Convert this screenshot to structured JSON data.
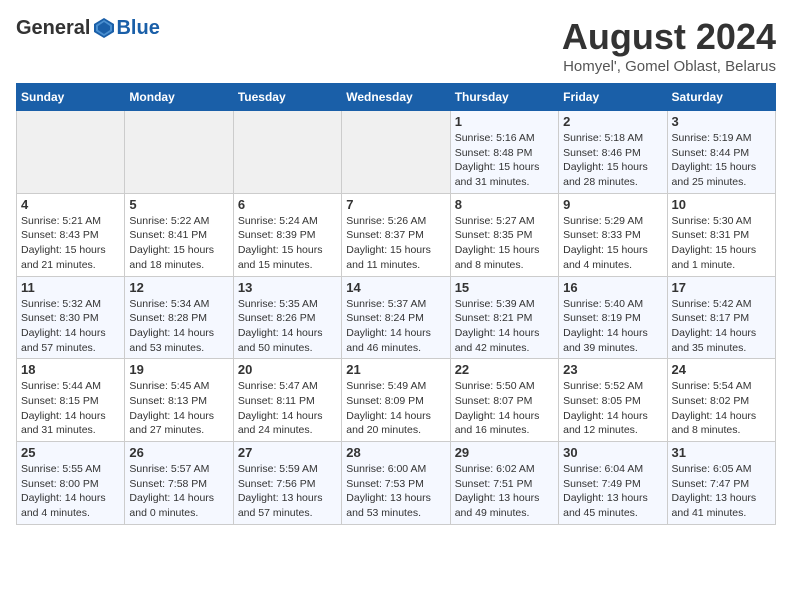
{
  "logo": {
    "general": "General",
    "blue": "Blue"
  },
  "title": "August 2024",
  "location": "Homyel', Gomel Oblast, Belarus",
  "weekdays": [
    "Sunday",
    "Monday",
    "Tuesday",
    "Wednesday",
    "Thursday",
    "Friday",
    "Saturday"
  ],
  "weeks": [
    [
      {
        "day": "",
        "info": ""
      },
      {
        "day": "",
        "info": ""
      },
      {
        "day": "",
        "info": ""
      },
      {
        "day": "",
        "info": ""
      },
      {
        "day": "1",
        "info": "Sunrise: 5:16 AM\nSunset: 8:48 PM\nDaylight: 15 hours\nand 31 minutes."
      },
      {
        "day": "2",
        "info": "Sunrise: 5:18 AM\nSunset: 8:46 PM\nDaylight: 15 hours\nand 28 minutes."
      },
      {
        "day": "3",
        "info": "Sunrise: 5:19 AM\nSunset: 8:44 PM\nDaylight: 15 hours\nand 25 minutes."
      }
    ],
    [
      {
        "day": "4",
        "info": "Sunrise: 5:21 AM\nSunset: 8:43 PM\nDaylight: 15 hours\nand 21 minutes."
      },
      {
        "day": "5",
        "info": "Sunrise: 5:22 AM\nSunset: 8:41 PM\nDaylight: 15 hours\nand 18 minutes."
      },
      {
        "day": "6",
        "info": "Sunrise: 5:24 AM\nSunset: 8:39 PM\nDaylight: 15 hours\nand 15 minutes."
      },
      {
        "day": "7",
        "info": "Sunrise: 5:26 AM\nSunset: 8:37 PM\nDaylight: 15 hours\nand 11 minutes."
      },
      {
        "day": "8",
        "info": "Sunrise: 5:27 AM\nSunset: 8:35 PM\nDaylight: 15 hours\nand 8 minutes."
      },
      {
        "day": "9",
        "info": "Sunrise: 5:29 AM\nSunset: 8:33 PM\nDaylight: 15 hours\nand 4 minutes."
      },
      {
        "day": "10",
        "info": "Sunrise: 5:30 AM\nSunset: 8:31 PM\nDaylight: 15 hours\nand 1 minute."
      }
    ],
    [
      {
        "day": "11",
        "info": "Sunrise: 5:32 AM\nSunset: 8:30 PM\nDaylight: 14 hours\nand 57 minutes."
      },
      {
        "day": "12",
        "info": "Sunrise: 5:34 AM\nSunset: 8:28 PM\nDaylight: 14 hours\nand 53 minutes."
      },
      {
        "day": "13",
        "info": "Sunrise: 5:35 AM\nSunset: 8:26 PM\nDaylight: 14 hours\nand 50 minutes."
      },
      {
        "day": "14",
        "info": "Sunrise: 5:37 AM\nSunset: 8:24 PM\nDaylight: 14 hours\nand 46 minutes."
      },
      {
        "day": "15",
        "info": "Sunrise: 5:39 AM\nSunset: 8:21 PM\nDaylight: 14 hours\nand 42 minutes."
      },
      {
        "day": "16",
        "info": "Sunrise: 5:40 AM\nSunset: 8:19 PM\nDaylight: 14 hours\nand 39 minutes."
      },
      {
        "day": "17",
        "info": "Sunrise: 5:42 AM\nSunset: 8:17 PM\nDaylight: 14 hours\nand 35 minutes."
      }
    ],
    [
      {
        "day": "18",
        "info": "Sunrise: 5:44 AM\nSunset: 8:15 PM\nDaylight: 14 hours\nand 31 minutes."
      },
      {
        "day": "19",
        "info": "Sunrise: 5:45 AM\nSunset: 8:13 PM\nDaylight: 14 hours\nand 27 minutes."
      },
      {
        "day": "20",
        "info": "Sunrise: 5:47 AM\nSunset: 8:11 PM\nDaylight: 14 hours\nand 24 minutes."
      },
      {
        "day": "21",
        "info": "Sunrise: 5:49 AM\nSunset: 8:09 PM\nDaylight: 14 hours\nand 20 minutes."
      },
      {
        "day": "22",
        "info": "Sunrise: 5:50 AM\nSunset: 8:07 PM\nDaylight: 14 hours\nand 16 minutes."
      },
      {
        "day": "23",
        "info": "Sunrise: 5:52 AM\nSunset: 8:05 PM\nDaylight: 14 hours\nand 12 minutes."
      },
      {
        "day": "24",
        "info": "Sunrise: 5:54 AM\nSunset: 8:02 PM\nDaylight: 14 hours\nand 8 minutes."
      }
    ],
    [
      {
        "day": "25",
        "info": "Sunrise: 5:55 AM\nSunset: 8:00 PM\nDaylight: 14 hours\nand 4 minutes."
      },
      {
        "day": "26",
        "info": "Sunrise: 5:57 AM\nSunset: 7:58 PM\nDaylight: 14 hours\nand 0 minutes."
      },
      {
        "day": "27",
        "info": "Sunrise: 5:59 AM\nSunset: 7:56 PM\nDaylight: 13 hours\nand 57 minutes."
      },
      {
        "day": "28",
        "info": "Sunrise: 6:00 AM\nSunset: 7:53 PM\nDaylight: 13 hours\nand 53 minutes."
      },
      {
        "day": "29",
        "info": "Sunrise: 6:02 AM\nSunset: 7:51 PM\nDaylight: 13 hours\nand 49 minutes."
      },
      {
        "day": "30",
        "info": "Sunrise: 6:04 AM\nSunset: 7:49 PM\nDaylight: 13 hours\nand 45 minutes."
      },
      {
        "day": "31",
        "info": "Sunrise: 6:05 AM\nSunset: 7:47 PM\nDaylight: 13 hours\nand 41 minutes."
      }
    ]
  ]
}
